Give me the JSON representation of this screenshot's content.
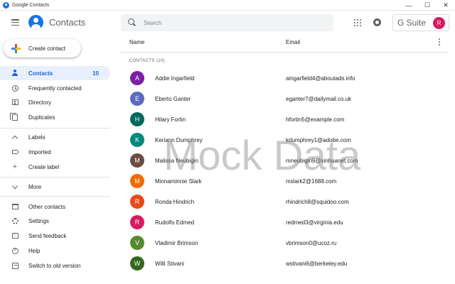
{
  "window": {
    "title": "Google Contacts",
    "controls": [
      "—",
      "☐",
      "✕"
    ]
  },
  "header": {
    "app_name": "Contacts",
    "search_placeholder": "Search",
    "gsuite_label": "G Suite",
    "avatar_initial": "R"
  },
  "sidebar": {
    "create_label": "Create contact",
    "items": [
      {
        "label": "Contacts",
        "count": "10",
        "icon": "person-icon",
        "active": true
      },
      {
        "label": "Frequently contacted",
        "icon": "history-icon"
      },
      {
        "label": "Directory",
        "icon": "building-icon"
      },
      {
        "label": "Duplicates",
        "icon": "copy-icon"
      },
      {
        "label": "Labels",
        "icon": "chevron-up-icon"
      },
      {
        "label": "Imported",
        "icon": "label-icon"
      },
      {
        "label": "Create label",
        "icon": "plus-icon"
      },
      {
        "label": "More",
        "icon": "chevron-down-icon"
      },
      {
        "label": "Other contacts",
        "icon": "inbox-icon"
      },
      {
        "label": "Settings",
        "icon": "gear-icon"
      },
      {
        "label": "Send feedback",
        "icon": "feedback-icon"
      },
      {
        "label": "Help",
        "icon": "help-icon"
      },
      {
        "label": "Switch to old version",
        "icon": "exit-icon"
      }
    ]
  },
  "list": {
    "columns": [
      "Name",
      "Email"
    ],
    "section_label": "CONTACTS (10)",
    "contacts": [
      {
        "initial": "A",
        "name": "Addie Ingarfield",
        "email": "aingarfield4@aboutads.info",
        "color": "#7b1fa2"
      },
      {
        "initial": "E",
        "name": "Eberto Ganter",
        "email": "eganter7@dailymail.co.uk",
        "color": "#5c6bc0"
      },
      {
        "initial": "H",
        "name": "Hilary Fortin",
        "email": "hfortin5@example.com",
        "color": "#00695c"
      },
      {
        "initial": "K",
        "name": "Keriann Dumphrey",
        "email": "kdumphrey1@adobe.com",
        "color": "#00897b"
      },
      {
        "initial": "M",
        "name": "Malissa Neubigin",
        "email": "mneubigin9@xinhuanet.com",
        "color": "#6d4c41"
      },
      {
        "initial": "M",
        "name": "Minnaminnie Slark",
        "email": "mslark2@1688.com",
        "color": "#ef6c00"
      },
      {
        "initial": "R",
        "name": "Ronda Hindrich",
        "email": "rhindrich8@squidoo.com",
        "color": "#e64a19"
      },
      {
        "initial": "R",
        "name": "Rudolfo Edmed",
        "email": "redmed3@virginia.edu",
        "color": "#d81b60"
      },
      {
        "initial": "V",
        "name": "Vladimir Brimson",
        "email": "vbrimson0@ucoz.ru",
        "color": "#558b2f"
      },
      {
        "initial": "W",
        "name": "Willi Stivani",
        "email": "wstivani6@berkeley.edu",
        "color": "#33691e"
      }
    ]
  },
  "watermark": "Mock Data",
  "colors": {
    "accent": "#1a73e8",
    "active_bg": "#e8f0fe",
    "active_text": "#1967d2"
  }
}
